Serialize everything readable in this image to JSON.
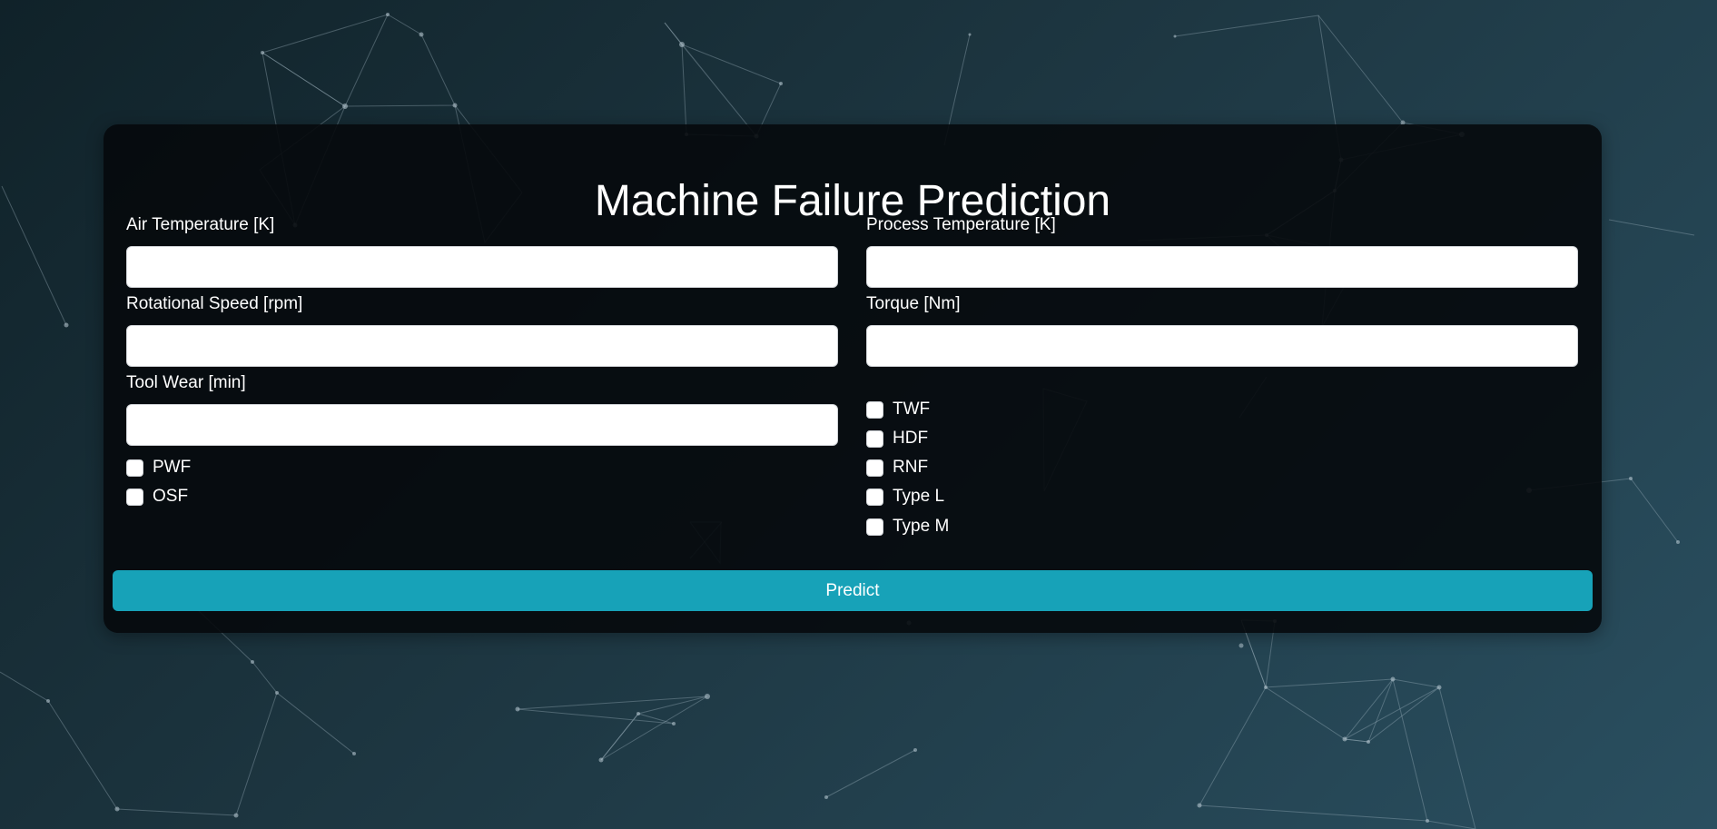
{
  "form": {
    "title": "Machine Failure Prediction",
    "fields": {
      "air_temperature": {
        "label": "Air Temperature [K]",
        "value": ""
      },
      "process_temperature": {
        "label": "Process Temperature [K]",
        "value": ""
      },
      "rotational_speed": {
        "label": "Rotational Speed [rpm]",
        "value": ""
      },
      "torque": {
        "label": "Torque [Nm]",
        "value": ""
      },
      "tool_wear": {
        "label": "Tool Wear [min]",
        "value": ""
      }
    },
    "checkboxes": {
      "pwf": {
        "label": "PWF",
        "checked": false
      },
      "osf": {
        "label": "OSF",
        "checked": false
      },
      "twf": {
        "label": "TWF",
        "checked": false
      },
      "hdf": {
        "label": "HDF",
        "checked": false
      },
      "rnf": {
        "label": "RNF",
        "checked": false
      },
      "type_l": {
        "label": "Type L",
        "checked": false
      },
      "type_m": {
        "label": "Type M",
        "checked": false
      }
    },
    "submit_label": "Predict"
  },
  "colors": {
    "background_start": "#102229",
    "background_end": "#2a4f60",
    "card": "#05090c",
    "accent": "#17a2b8"
  }
}
